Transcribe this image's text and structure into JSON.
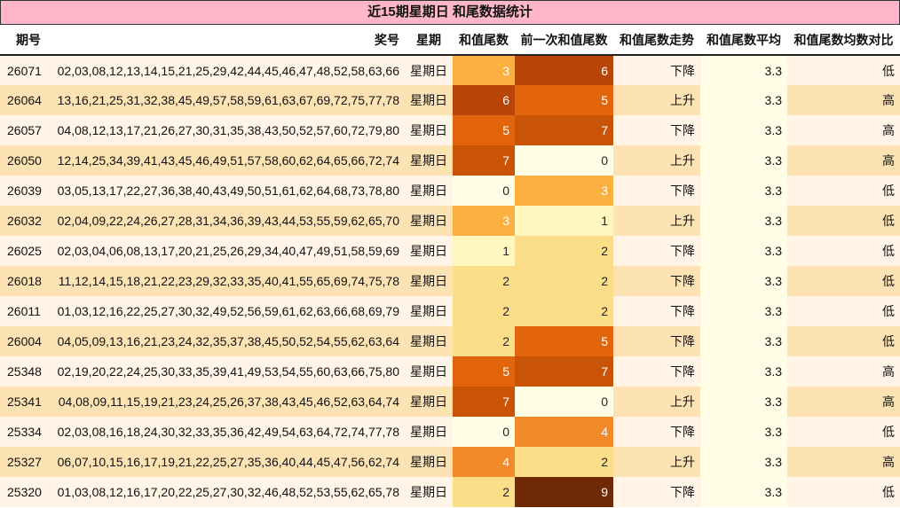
{
  "title": "近15期星期日 和尾数据统计",
  "columns": [
    "期号",
    "奖号",
    "星期",
    "和值尾数",
    "前一次和值尾数",
    "和值尾数走势",
    "和值尾数平均",
    "和值尾数均数对比"
  ],
  "colors": {
    "row_odd": "#fff4e6",
    "row_even": "#fde3b3",
    "heat": {
      "0": "#fffde6",
      "1": "#fff6c0",
      "2": "#fcde88",
      "3": "#fbb040",
      "4": "#f38a2a",
      "5": "#e2640c",
      "6": "#b84405",
      "7": "#c95406",
      "9": "#6f2a05"
    },
    "avg_col": "#fffde6"
  },
  "rows": [
    {
      "issue": "26071",
      "numbers": "02,03,08,12,13,14,15,21,25,29,42,44,45,46,47,48,52,58,63,66",
      "day": "星期日",
      "tail": "3",
      "prev": "6",
      "trend": "下降",
      "avg": "3.3",
      "cmp": "低"
    },
    {
      "issue": "26064",
      "numbers": "13,16,21,25,31,32,38,45,49,57,58,59,61,63,67,69,72,75,77,78",
      "day": "星期日",
      "tail": "6",
      "prev": "5",
      "trend": "上升",
      "avg": "3.3",
      "cmp": "高"
    },
    {
      "issue": "26057",
      "numbers": "04,08,12,13,17,21,26,27,30,31,35,38,43,50,52,57,60,72,79,80",
      "day": "星期日",
      "tail": "5",
      "prev": "7",
      "trend": "下降",
      "avg": "3.3",
      "cmp": "高"
    },
    {
      "issue": "26050",
      "numbers": "12,14,25,34,39,41,43,45,46,49,51,57,58,60,62,64,65,66,72,74",
      "day": "星期日",
      "tail": "7",
      "prev": "0",
      "trend": "上升",
      "avg": "3.3",
      "cmp": "高"
    },
    {
      "issue": "26039",
      "numbers": "03,05,13,17,22,27,36,38,40,43,49,50,51,61,62,64,68,73,78,80",
      "day": "星期日",
      "tail": "0",
      "prev": "3",
      "trend": "下降",
      "avg": "3.3",
      "cmp": "低"
    },
    {
      "issue": "26032",
      "numbers": "02,04,09,22,24,26,27,28,31,34,36,39,43,44,53,55,59,62,65,70",
      "day": "星期日",
      "tail": "3",
      "prev": "1",
      "trend": "上升",
      "avg": "3.3",
      "cmp": "低"
    },
    {
      "issue": "26025",
      "numbers": "02,03,04,06,08,13,17,20,21,25,26,29,34,40,47,49,51,58,59,69",
      "day": "星期日",
      "tail": "1",
      "prev": "2",
      "trend": "下降",
      "avg": "3.3",
      "cmp": "低"
    },
    {
      "issue": "26018",
      "numbers": "11,12,14,15,18,21,22,23,29,32,33,35,40,41,55,65,69,74,75,78",
      "day": "星期日",
      "tail": "2",
      "prev": "2",
      "trend": "下降",
      "avg": "3.3",
      "cmp": "低"
    },
    {
      "issue": "26011",
      "numbers": "01,03,12,16,22,25,27,30,32,49,52,56,59,61,62,63,66,68,69,79",
      "day": "星期日",
      "tail": "2",
      "prev": "2",
      "trend": "下降",
      "avg": "3.3",
      "cmp": "低"
    },
    {
      "issue": "26004",
      "numbers": "04,05,09,13,16,21,23,24,32,35,37,38,45,50,52,54,55,62,63,64",
      "day": "星期日",
      "tail": "2",
      "prev": "5",
      "trend": "下降",
      "avg": "3.3",
      "cmp": "低"
    },
    {
      "issue": "25348",
      "numbers": "02,19,20,22,24,25,30,33,35,39,41,49,53,54,55,60,63,66,75,80",
      "day": "星期日",
      "tail": "5",
      "prev": "7",
      "trend": "下降",
      "avg": "3.3",
      "cmp": "高"
    },
    {
      "issue": "25341",
      "numbers": "04,08,09,11,15,19,21,23,24,25,26,37,38,43,45,46,52,63,64,74",
      "day": "星期日",
      "tail": "7",
      "prev": "0",
      "trend": "上升",
      "avg": "3.3",
      "cmp": "高"
    },
    {
      "issue": "25334",
      "numbers": "02,03,08,16,18,24,30,32,33,35,36,42,49,54,63,64,72,74,77,78",
      "day": "星期日",
      "tail": "0",
      "prev": "4",
      "trend": "下降",
      "avg": "3.3",
      "cmp": "低"
    },
    {
      "issue": "25327",
      "numbers": "06,07,10,15,16,17,19,21,22,25,27,35,36,40,44,45,47,56,62,74",
      "day": "星期日",
      "tail": "4",
      "prev": "2",
      "trend": "上升",
      "avg": "3.3",
      "cmp": "高"
    },
    {
      "issue": "25320",
      "numbers": "01,03,08,12,16,17,20,22,25,27,30,32,46,48,52,53,55,62,65,78",
      "day": "星期日",
      "tail": "2",
      "prev": "9",
      "trend": "下降",
      "avg": "3.3",
      "cmp": "低"
    }
  ]
}
